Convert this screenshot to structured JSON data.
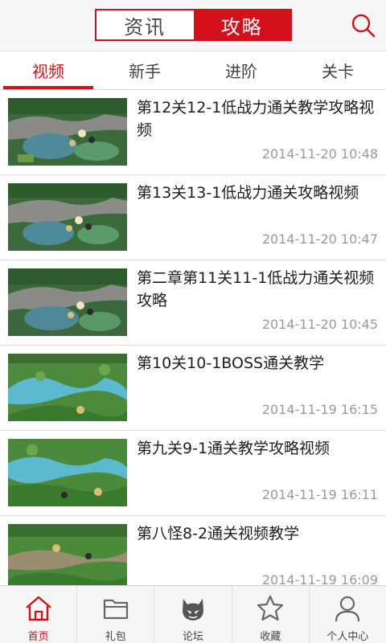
{
  "header": {
    "segments": [
      {
        "label": "资讯",
        "active": false
      },
      {
        "label": "攻略",
        "active": true
      }
    ],
    "search_icon": "search-icon"
  },
  "subtabs": [
    {
      "label": "视频",
      "active": true
    },
    {
      "label": "新手",
      "active": false
    },
    {
      "label": "进阶",
      "active": false
    },
    {
      "label": "关卡",
      "active": false
    }
  ],
  "articles": [
    {
      "title": "第12关12-1低战力通关教学攻略视频",
      "time": "2014-11-20 10:48",
      "thumb_style": "gray-road"
    },
    {
      "title": "第13关13-1低战力通关攻略视频",
      "time": "2014-11-20 10:47",
      "thumb_style": "gray-road"
    },
    {
      "title": "第二章第11关11-1低战力通关视频攻略",
      "time": "2014-11-20 10:45",
      "thumb_style": "gray-road"
    },
    {
      "title": "第10关10-1BOSS通关教学",
      "time": "2014-11-19 16:15",
      "thumb_style": "river"
    },
    {
      "title": "第九关9-1通关教学攻略视频",
      "time": "2014-11-19 16:11",
      "thumb_style": "river"
    },
    {
      "title": "第八怪8-2通关视频教学",
      "time": "2014-11-19 16:09",
      "thumb_style": "path"
    }
  ],
  "bottom_nav": [
    {
      "label": "首页",
      "icon": "home-icon",
      "active": true
    },
    {
      "label": "礼包",
      "icon": "folder-icon",
      "active": false
    },
    {
      "label": "论坛",
      "icon": "mask-icon",
      "active": false
    },
    {
      "label": "收藏",
      "icon": "star-icon",
      "active": false
    },
    {
      "label": "个人中心",
      "icon": "user-icon",
      "active": false
    }
  ],
  "colors": {
    "accent": "#d4111b"
  }
}
